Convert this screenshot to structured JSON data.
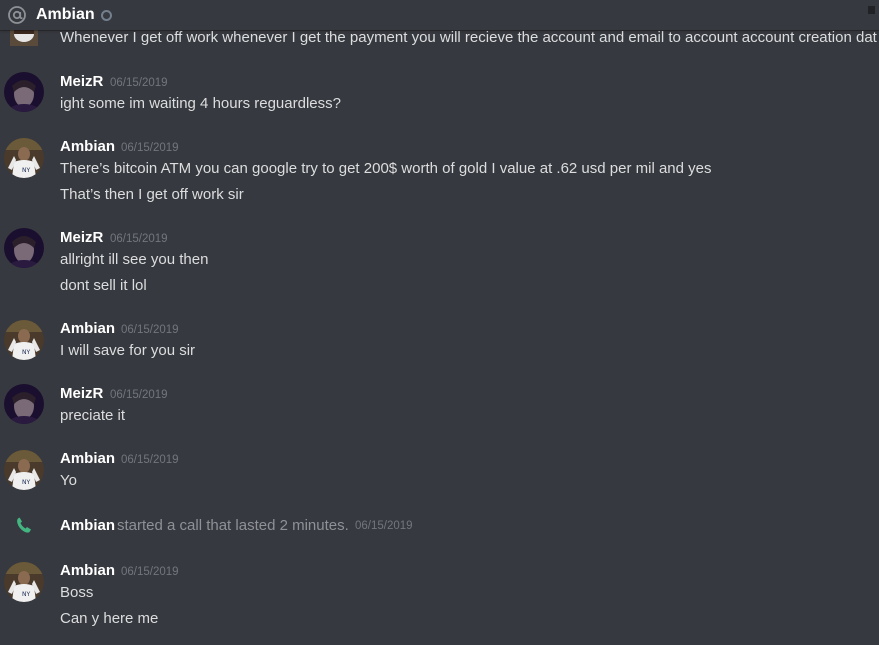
{
  "header": {
    "icon": "at-icon",
    "title": "Ambian",
    "status": "offline",
    "accent": "#747f8d"
  },
  "cut_message": {
    "text": "Whenever I get off work whenever I get the payment you will recieve the account and email to account account creation dat"
  },
  "messages": [
    {
      "author": "MeizR",
      "timestamp": "06/15/2019",
      "lines": [
        "ight some im waiting 4 hours reguardless?"
      ]
    },
    {
      "author": "Ambian",
      "timestamp": "06/15/2019",
      "lines": [
        "There’s bitcoin ATM you can google try to get 200$ worth of gold I value at .62 usd per mil and yes",
        "That’s then I get off work sir"
      ]
    },
    {
      "author": "MeizR",
      "timestamp": "06/15/2019",
      "lines": [
        "allright ill see you then",
        "dont sell it lol"
      ]
    },
    {
      "author": "Ambian",
      "timestamp": "06/15/2019",
      "lines": [
        "I will save for you sir"
      ]
    },
    {
      "author": "MeizR",
      "timestamp": "06/15/2019",
      "lines": [
        "preciate it"
      ]
    },
    {
      "author": "Ambian",
      "timestamp": "06/15/2019",
      "lines": [
        "Yo"
      ]
    },
    {
      "author": "Ambian",
      "timestamp": "06/15/2019",
      "lines": [
        "Boss",
        "Can y here me"
      ]
    }
  ],
  "call": {
    "icon": "phone-icon",
    "author": "Ambian",
    "text": "started a call that lasted 2 minutes.",
    "timestamp": "06/15/2019",
    "color": "#43b581"
  },
  "colors": {
    "background": "#36393f",
    "username": "#ffffff",
    "text": "#dcddde",
    "timestamp": "#72767d"
  }
}
